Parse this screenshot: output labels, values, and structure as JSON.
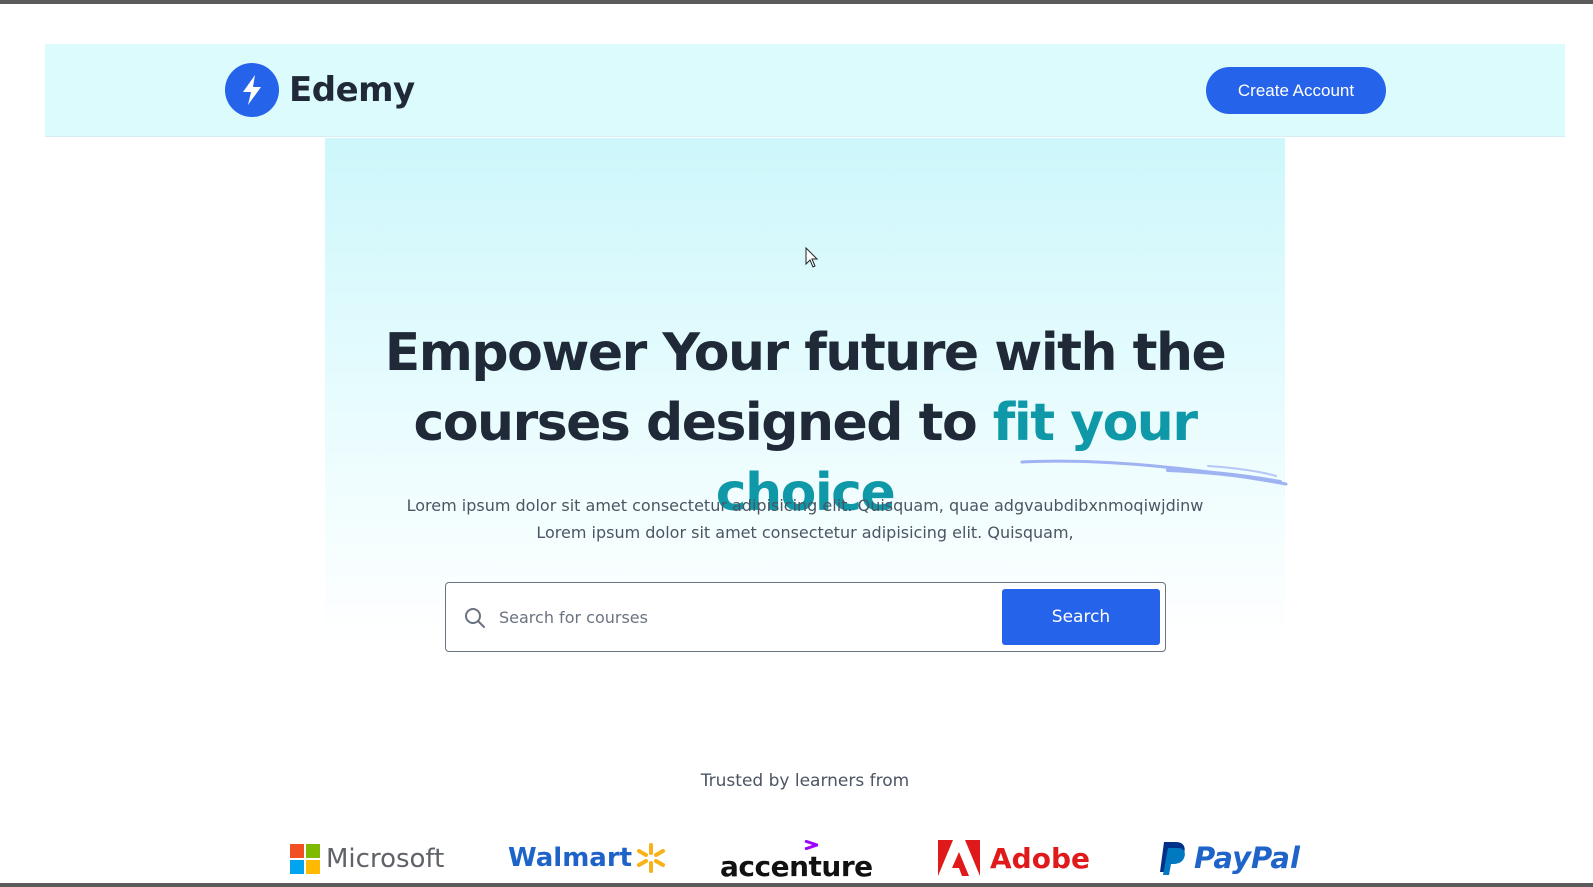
{
  "navbar": {
    "brand_name": "Edemy",
    "create_account_label": "Create Account"
  },
  "hero": {
    "headline_line1": "Empower Your future with the",
    "headline_line2_plain": "courses designed to ",
    "headline_line2_accent": "fit your choice",
    "subtext_line1": "Lorem ipsum dolor sit amet consectetur adipisicing elit. Quisquam, quae adgvaubdibxnmoqiwjdinw",
    "subtext_line2": "Lorem ipsum dolor sit amet consectetur adipisicing elit. Quisquam,"
  },
  "search": {
    "placeholder": "Search for courses",
    "button_label": "Search"
  },
  "trusted": {
    "heading": "Trusted by learners from",
    "brands": [
      "Microsoft",
      "Walmart",
      "accenture",
      "Adobe",
      "PayPal"
    ]
  },
  "colors": {
    "primary": "#2563eb",
    "accent_teal": "#0e98a8",
    "navbar_bg": "#dcfbfd",
    "heading_text": "#1f2937"
  }
}
